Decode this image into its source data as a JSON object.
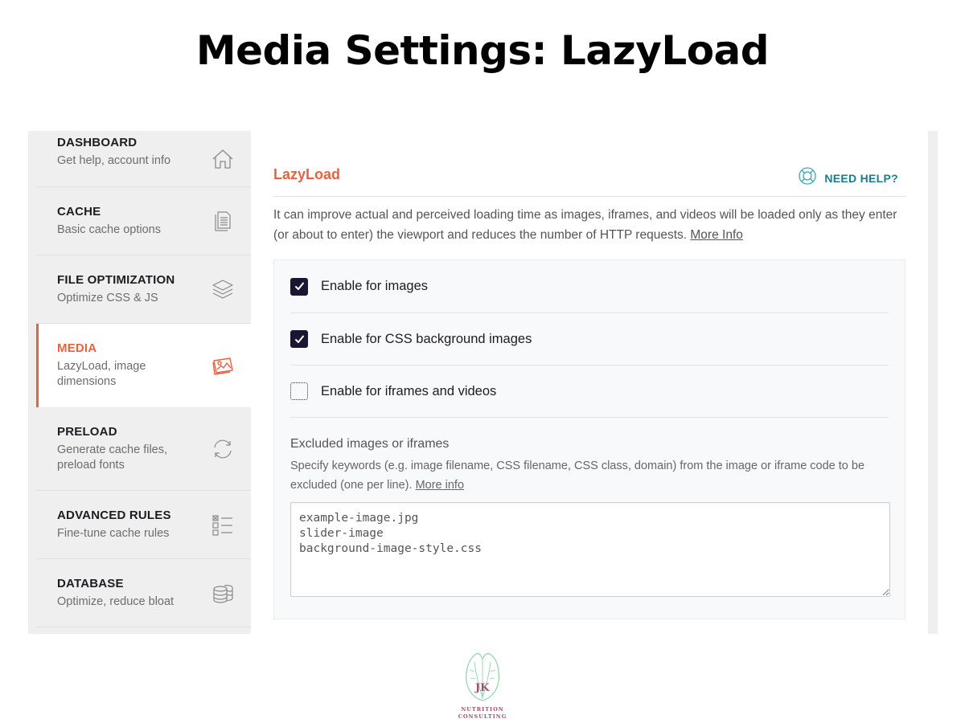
{
  "page_title": "Media Settings: LazyLoad",
  "sidebar": {
    "items": [
      {
        "title": "DASHBOARD",
        "subtitle": "Get help, account info",
        "icon": "home-icon",
        "active": false
      },
      {
        "title": "CACHE",
        "subtitle": "Basic cache options",
        "icon": "document-icon",
        "active": false
      },
      {
        "title": "FILE OPTIMIZATION",
        "subtitle": "Optimize CSS & JS",
        "icon": "layers-icon",
        "active": false
      },
      {
        "title": "MEDIA",
        "subtitle": "LazyLoad, image dimensions",
        "icon": "images-icon",
        "active": true
      },
      {
        "title": "PRELOAD",
        "subtitle": "Generate cache files, preload fonts",
        "icon": "refresh-icon",
        "active": false
      },
      {
        "title": "ADVANCED RULES",
        "subtitle": "Fine-tune cache rules",
        "icon": "checklist-icon",
        "active": false
      },
      {
        "title": "DATABASE",
        "subtitle": "Optimize, reduce bloat",
        "icon": "database-icon",
        "active": false
      }
    ]
  },
  "section": {
    "title": "LazyLoad",
    "help_label": "NEED HELP?",
    "help_icon": "lifebuoy-icon",
    "description": "It can improve actual and perceived loading time as images, iframes, and videos will be loaded only as they enter (or about to enter) the viewport and reduces the number of HTTP requests.",
    "more_info_label": "More Info"
  },
  "options": [
    {
      "label": "Enable for images",
      "checked": true
    },
    {
      "label": "Enable for CSS background images",
      "checked": true
    },
    {
      "label": "Enable for iframes and videos",
      "checked": false
    }
  ],
  "excluded": {
    "title": "Excluded images or iframes",
    "description": "Specify keywords (e.g. image filename, CSS filename, CSS class, domain) from the image or iframe code to be excluded (one per line).",
    "more_info_label": "More info",
    "value": "example-image.jpg\nslider-image\nbackground-image-style.css"
  },
  "logo": {
    "line1": "NUTRITION",
    "line2": "CONSULTING",
    "initials": "JK"
  },
  "colors": {
    "accent": "#e8623f",
    "help": "#1e7c8a",
    "checkbox": "#1b1534"
  }
}
